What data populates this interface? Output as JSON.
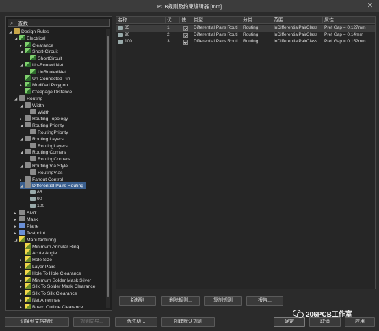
{
  "window": {
    "title": "PCB规则及约束编辑器 [mm]",
    "close_glyph": "✕"
  },
  "search": {
    "value": "查找"
  },
  "tree": [
    {
      "label": "Design Rules",
      "arrow": "◢",
      "icon": "folder"
    },
    {
      "label": "Electrical",
      "arrow": "◢",
      "icon": "rule"
    },
    {
      "label": "Clearance",
      "arrow": "▸",
      "icon": "rule"
    },
    {
      "label": "Short-Circuit",
      "arrow": "◢",
      "icon": "rule"
    },
    {
      "label": "ShortCircuit",
      "arrow": "",
      "icon": "rule"
    },
    {
      "label": "Un-Routed Net",
      "arrow": "◢",
      "icon": "rule"
    },
    {
      "label": "UnRoutedNet",
      "arrow": "",
      "icon": "rule"
    },
    {
      "label": "Un-Connected Pin",
      "arrow": "",
      "icon": "rule"
    },
    {
      "label": "Modified Polygon",
      "arrow": "▸",
      "icon": "rule"
    },
    {
      "label": "Creepage Distance",
      "arrow": "",
      "icon": "rule"
    },
    {
      "label": "Routing",
      "arrow": "◢",
      "icon": "gen"
    },
    {
      "label": "Width",
      "arrow": "◢",
      "icon": "gen"
    },
    {
      "label": "Width",
      "arrow": "",
      "icon": "gen"
    },
    {
      "label": "Routing Topology",
      "arrow": "▸",
      "icon": "gen"
    },
    {
      "label": "Routing Priority",
      "arrow": "◢",
      "icon": "gen"
    },
    {
      "label": "RoutingPriority",
      "arrow": "",
      "icon": "gen"
    },
    {
      "label": "Routing Layers",
      "arrow": "◢",
      "icon": "gen"
    },
    {
      "label": "RoutingLayers",
      "arrow": "",
      "icon": "gen"
    },
    {
      "label": "Routing Corners",
      "arrow": "◢",
      "icon": "gen"
    },
    {
      "label": "RoutingCorners",
      "arrow": "",
      "icon": "gen"
    },
    {
      "label": "Routing Via Style",
      "arrow": "◢",
      "icon": "gen"
    },
    {
      "label": "RoutingVias",
      "arrow": "",
      "icon": "gen"
    },
    {
      "label": "Fanout Control",
      "arrow": "▸",
      "icon": "gen"
    },
    {
      "label": "Differential Pairs Routing",
      "arrow": "◢",
      "icon": "gen"
    },
    {
      "label": "85",
      "arrow": "",
      "icon": "small"
    },
    {
      "label": "90",
      "arrow": "",
      "icon": "small"
    },
    {
      "label": "100",
      "arrow": "",
      "icon": "small"
    },
    {
      "label": "SMT",
      "arrow": "▸",
      "icon": "gen"
    },
    {
      "label": "Mask",
      "arrow": "▸",
      "icon": "gen"
    },
    {
      "label": "Plane",
      "arrow": "▸",
      "icon": "blue"
    },
    {
      "label": "Testpoint",
      "arrow": "▸",
      "icon": "blue"
    },
    {
      "label": "Manufacturing",
      "arrow": "◢",
      "icon": "mfg"
    },
    {
      "label": "Minimum Annular Ring",
      "arrow": "",
      "icon": "mfg"
    },
    {
      "label": "Acute Angle",
      "arrow": "",
      "icon": "mfg"
    },
    {
      "label": "Hole Size",
      "arrow": "▸",
      "icon": "mfg"
    },
    {
      "label": "Layer Pairs",
      "arrow": "▸",
      "icon": "mfg"
    },
    {
      "label": "Hole To Hole Clearance",
      "arrow": "▸",
      "icon": "mfg"
    },
    {
      "label": "Minimum Solder Mask Sliver",
      "arrow": "▸",
      "icon": "mfg"
    },
    {
      "label": "Silk To Solder Mask Clearance",
      "arrow": "▸",
      "icon": "mfg"
    },
    {
      "label": "Silk To Silk Clearance",
      "arrow": "▸",
      "icon": "mfg"
    },
    {
      "label": "Net Antennae",
      "arrow": "▸",
      "icon": "mfg"
    },
    {
      "label": "Board Outline Clearance",
      "arrow": "▸",
      "icon": "mfg"
    }
  ],
  "table": {
    "headers": [
      "名称",
      "优",
      "使...",
      "类型",
      "分类",
      "范围",
      "属性"
    ],
    "rows": [
      {
        "name": "85",
        "priority": "1",
        "type": "Differential Pairs Routi",
        "category": "Routing",
        "scope": "InDifferentialPairClass",
        "attr": "Pref Gap = 0.127mm"
      },
      {
        "name": "90",
        "priority": "2",
        "type": "Differential Pairs Routi",
        "category": "Routing",
        "scope": "InDifferentialPairClass",
        "attr": "Pref Gap = 0.14mm"
      },
      {
        "name": "100",
        "priority": "3",
        "type": "Differential Pairs Routi",
        "category": "Routing",
        "scope": "InDifferentialPairClass",
        "attr": "Pref Gap = 0.152mm"
      }
    ]
  },
  "actions": {
    "new": "新规则",
    "delete": "删除规则...",
    "copy": "复制规则",
    "report": "报告..."
  },
  "footer": {
    "doc_view": "切换到文档视图",
    "rule_wizard": "规则向导...",
    "priority": "优先级...",
    "default_rules": "创建默认规则",
    "ok": "确定",
    "cancel": "取消",
    "apply": "应用"
  },
  "watermark": {
    "text": "206PCB工作室"
  }
}
